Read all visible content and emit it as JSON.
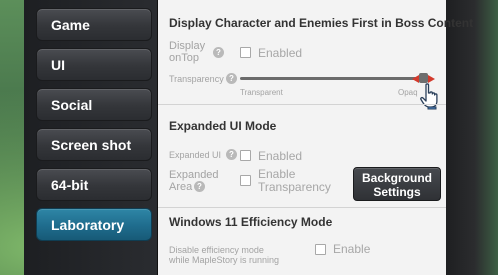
{
  "sidebar": {
    "items": [
      {
        "label": "Game",
        "active": false
      },
      {
        "label": "UI",
        "active": false
      },
      {
        "label": "Social",
        "active": false
      },
      {
        "label": "Screen shot",
        "active": false
      },
      {
        "label": "64-bit",
        "active": false
      },
      {
        "label": "Laboratory",
        "active": true
      }
    ]
  },
  "sections": {
    "boss": {
      "title": "Display Character and Enemies First in Boss Content",
      "display_on_top_label_1": "Display",
      "display_on_top_label_2": "onTop",
      "display_on_top_checkbox_label": "Enabled",
      "display_on_top_checked": false,
      "transparency_label": "Transparency",
      "slider_min_label": "Transparent",
      "slider_max_label": "Opaq",
      "slider_value_fraction": 0.95
    },
    "expanded_ui": {
      "title": "Expanded UI Mode",
      "expanded_ui_label": "Expanded UI",
      "expanded_ui_checkbox_label": "Enabled",
      "expanded_ui_checked": false,
      "expanded_area_label_1": "Expanded",
      "expanded_area_label_2": "Area",
      "enable_transparency_label_1": "Enable",
      "enable_transparency_label_2": "Transparency",
      "enable_transparency_checked": false,
      "background_settings_label_1": "Background",
      "background_settings_label_2": "Settings"
    },
    "windows11": {
      "title": "Windows 11 Efficiency Mode",
      "disable_label_1": "Disable efficiency mode",
      "disable_label_2": "while MapleStory is running",
      "enable_checkbox_label": "Enable",
      "enable_checked": false
    }
  },
  "colors": {
    "active_tab": "#1f6c8d",
    "slider_arrows": "#d33a2c"
  }
}
